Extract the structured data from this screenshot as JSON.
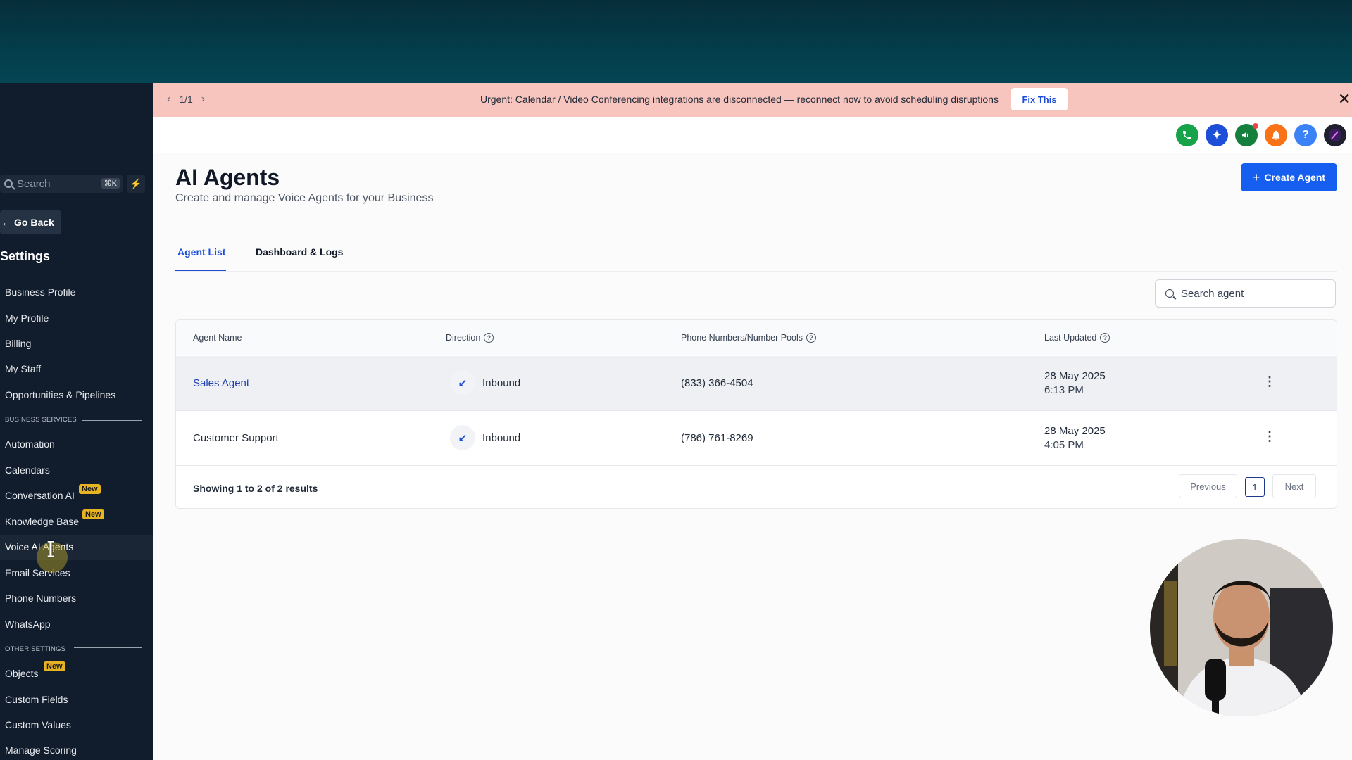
{
  "banner": {
    "pager": "1/1",
    "message": "Urgent: Calendar / Video Conferencing integrations are disconnected — reconnect now to avoid scheduling disruptions",
    "action": "Fix This"
  },
  "sidebar": {
    "search_placeholder": "Search",
    "search_shortcut": "⌘K",
    "go_back": "Go Back",
    "title": "Settings",
    "items": [
      {
        "label": "Business Profile"
      },
      {
        "label": "My Profile"
      },
      {
        "label": "Billing"
      },
      {
        "label": "My Staff"
      },
      {
        "label": "Opportunities & Pipelines"
      },
      {
        "label": "Automation"
      },
      {
        "label": "Calendars"
      },
      {
        "label": "Conversation AI",
        "badge": "New"
      },
      {
        "label": "Knowledge Base",
        "badge": "New"
      },
      {
        "label": "Voice AI Agents",
        "active": true
      },
      {
        "label": "Email Services"
      },
      {
        "label": "Phone Numbers"
      },
      {
        "label": "WhatsApp"
      },
      {
        "label": "Objects",
        "badge": "New"
      },
      {
        "label": "Custom Fields"
      },
      {
        "label": "Custom Values"
      },
      {
        "label": "Manage Scoring"
      }
    ],
    "sections": {
      "business": "BUSINESS SERVICES",
      "other": "OTHER SETTINGS"
    }
  },
  "topbar": {
    "icons": [
      "phone-icon",
      "sparkle-icon",
      "megaphone-icon",
      "bell-icon",
      "help-icon",
      "avatar"
    ],
    "help_glyph": "?"
  },
  "page": {
    "title": "AI Agents",
    "subtitle": "Create and manage Voice Agents for your Business",
    "create_button": "Create Agent"
  },
  "tabs": [
    {
      "label": "Agent List",
      "active": true
    },
    {
      "label": "Dashboard & Logs",
      "active": false
    }
  ],
  "search": {
    "placeholder": "Search agent"
  },
  "table": {
    "headers": [
      "Agent Name",
      "Direction",
      "Phone Numbers/Number Pools",
      "Last Updated"
    ],
    "rows": [
      {
        "name": "Sales Agent",
        "direction": "Inbound",
        "phone": "(833) 366-4504",
        "date": "28 May 2025",
        "time": "6:13 PM"
      },
      {
        "name": "Customer Support",
        "direction": "Inbound",
        "phone": "(786) 761-8269",
        "date": "28 May 2025",
        "time": "4:05 PM"
      }
    ],
    "footer": "Showing 1 to 2 of 2 results",
    "pagination": {
      "previous": "Previous",
      "page": "1",
      "next": "Next"
    }
  },
  "colors": {
    "accent": "#155eef",
    "banner": "#f7c4be",
    "sidebar": "#111c2c",
    "badge": "#e6b422"
  }
}
